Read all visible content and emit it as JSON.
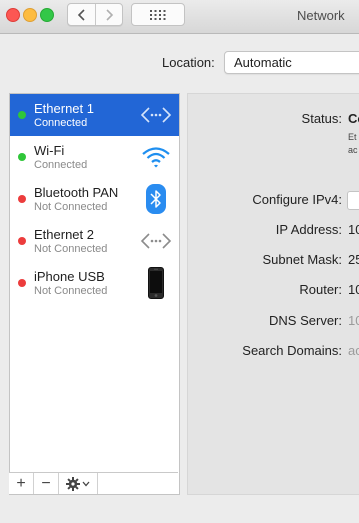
{
  "window": {
    "title": "Network"
  },
  "location": {
    "label": "Location:",
    "value": "Automatic"
  },
  "services": [
    {
      "name": "Ethernet 1",
      "status": "Connected",
      "dot": "green",
      "icon": "ethernet-icon",
      "selected": true
    },
    {
      "name": "Wi-Fi",
      "status": "Connected",
      "dot": "green",
      "icon": "wifi-icon",
      "selected": false
    },
    {
      "name": "Bluetooth PAN",
      "status": "Not Connected",
      "dot": "red",
      "icon": "bluetooth-icon",
      "selected": false
    },
    {
      "name": "Ethernet 2",
      "status": "Not Connected",
      "dot": "red",
      "icon": "ethernet-icon",
      "selected": false
    },
    {
      "name": "iPhone USB",
      "status": "Not Connected",
      "dot": "red",
      "icon": "iphone-icon",
      "selected": false
    }
  ],
  "sidebar_footer": {
    "add": "+",
    "remove": "−"
  },
  "details": {
    "status_label": "Status:",
    "status_value": "Co",
    "status_text_1": "Et",
    "status_text_2": "ac",
    "ipv4_label": "Configure IPv4:",
    "ip_label": "IP Address:",
    "ip_value": "10",
    "subnet_label": "Subnet Mask:",
    "subnet_value": "25",
    "router_label": "Router:",
    "router_value": "10",
    "dns_label": "DNS Server:",
    "dns_value": "10",
    "search_label": "Search Domains:",
    "search_value": "ac"
  },
  "colors": {
    "selection": "#2266d6",
    "status_green": "#2fc639",
    "status_red": "#ec3c3c",
    "bluetooth": "#2a8cf0"
  }
}
